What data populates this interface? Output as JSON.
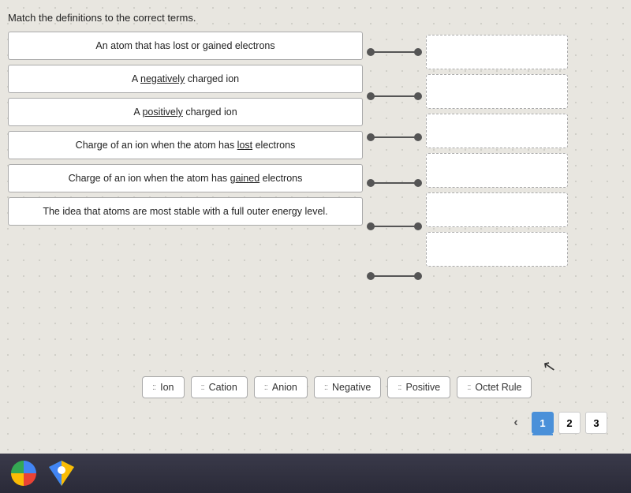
{
  "instructions": "Match the definitions to the correct terms.",
  "definitions": [
    {
      "id": 1,
      "text": "An atom that has lost or gained electrons",
      "underlined": null
    },
    {
      "id": 2,
      "text": "A negatively charged ion",
      "underlined": "negatively"
    },
    {
      "id": 3,
      "text": "A positively charged ion",
      "underlined": "positively"
    },
    {
      "id": 4,
      "text": "Charge of an ion when the atom has lost electrons",
      "underlined": "lost"
    },
    {
      "id": 5,
      "text": "Charge of an ion when the atom has gained electrons",
      "underlined": "gained"
    },
    {
      "id": 6,
      "text": "The idea that atoms are most stable with a full outer energy level.",
      "underlined": null
    }
  ],
  "terms": [
    {
      "id": 1,
      "label": "Ion"
    },
    {
      "id": 2,
      "label": "Cation"
    },
    {
      "id": 3,
      "label": "Anion"
    },
    {
      "id": 4,
      "label": "Negative"
    },
    {
      "id": 5,
      "label": "Positive"
    },
    {
      "id": 6,
      "label": "Octet Rule"
    }
  ],
  "pagination": {
    "prev_arrow": "‹",
    "pages": [
      "1",
      "2",
      "3"
    ],
    "active_page": "1"
  }
}
